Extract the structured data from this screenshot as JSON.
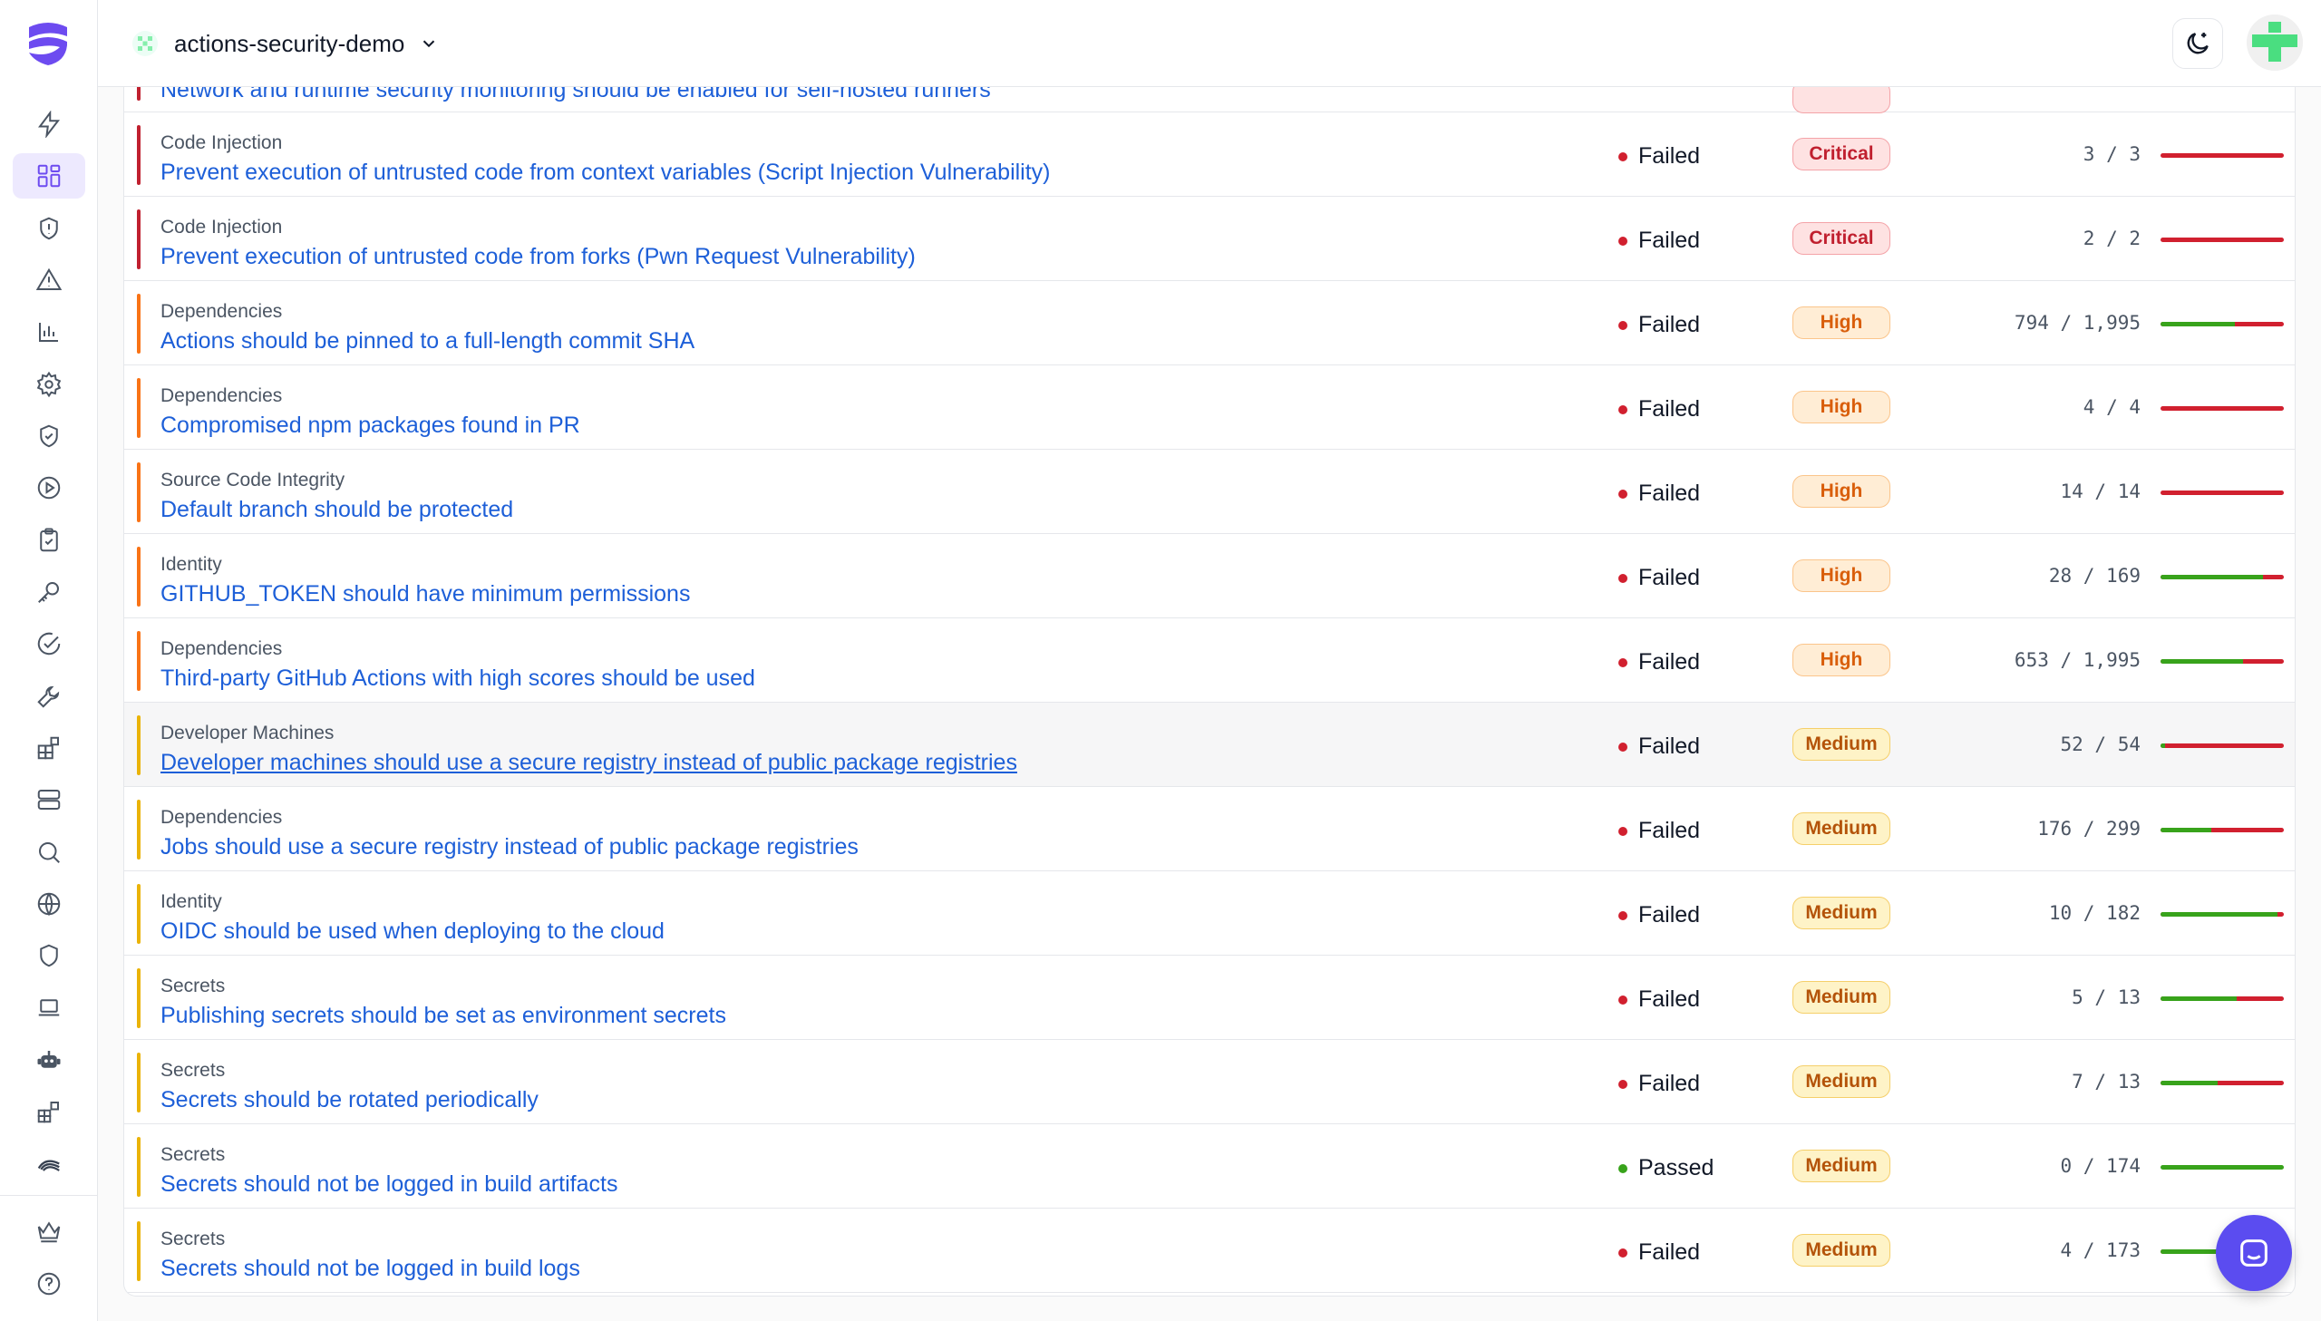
{
  "header": {
    "repo_name": "actions-security-demo"
  },
  "colors": {
    "accent": "#5b4cf0",
    "critical": "#c0202f",
    "high": "#f97316",
    "medium": "#eab308",
    "failed": "#d1202f",
    "passed": "#38a31b",
    "link": "#1d5fd8"
  },
  "sidebar": {
    "items": [
      {
        "icon": "lightning-icon"
      },
      {
        "icon": "dashboard-grid-icon",
        "active": true
      },
      {
        "icon": "shield-alert-icon"
      },
      {
        "icon": "warning-icon"
      },
      {
        "icon": "bar-chart-icon"
      },
      {
        "icon": "gear-icon"
      },
      {
        "icon": "shield-check-icon"
      },
      {
        "icon": "play-circle-icon"
      },
      {
        "icon": "clipboard-check-icon"
      },
      {
        "icon": "key-icon"
      },
      {
        "icon": "check-circle-icon"
      },
      {
        "icon": "wrench-icon"
      },
      {
        "icon": "puzzle-blocks-icon"
      },
      {
        "icon": "server-icon"
      },
      {
        "icon": "search-icon"
      },
      {
        "icon": "globe-icon"
      },
      {
        "icon": "shield-icon"
      },
      {
        "icon": "laptop-icon"
      },
      {
        "icon": "robot-icon"
      },
      {
        "icon": "blocks-icon"
      },
      {
        "icon": "waves-icon"
      },
      {
        "icon": "crown-icon"
      },
      {
        "icon": "help-icon"
      }
    ]
  },
  "top_cut_row": {
    "title": "Network and runtime security monitoring should be enabled for self-hosted runners"
  },
  "checks": [
    {
      "category": "Code Injection",
      "title": "Prevent execution of untrusted code from context variables (Script Injection Vulnerability)",
      "status": "Failed",
      "severity": "Critical",
      "failing": 3,
      "total": 3,
      "count_text": "3 / 3"
    },
    {
      "category": "Code Injection",
      "title": "Prevent execution of untrusted code from forks (Pwn Request Vulnerability)",
      "status": "Failed",
      "severity": "Critical",
      "failing": 2,
      "total": 2,
      "count_text": "2 / 2"
    },
    {
      "category": "Dependencies",
      "title": "Actions should be pinned to a full-length commit SHA",
      "status": "Failed",
      "severity": "High",
      "failing": 794,
      "total": 1995,
      "count_text": "794 / 1,995"
    },
    {
      "category": "Dependencies",
      "title": "Compromised npm packages found in PR",
      "status": "Failed",
      "severity": "High",
      "failing": 4,
      "total": 4,
      "count_text": "4 / 4"
    },
    {
      "category": "Source Code Integrity",
      "title": "Default branch should be protected",
      "status": "Failed",
      "severity": "High",
      "failing": 14,
      "total": 14,
      "count_text": "14 / 14"
    },
    {
      "category": "Identity",
      "title": "GITHUB_TOKEN should have minimum permissions",
      "status": "Failed",
      "severity": "High",
      "failing": 28,
      "total": 169,
      "count_text": "28 / 169"
    },
    {
      "category": "Dependencies",
      "title": "Third-party GitHub Actions with high scores should be used",
      "status": "Failed",
      "severity": "High",
      "failing": 653,
      "total": 1995,
      "count_text": "653 / 1,995"
    },
    {
      "category": "Developer Machines",
      "title": "Developer machines should use a secure registry instead of public package registries",
      "status": "Failed",
      "severity": "Medium",
      "failing": 52,
      "total": 54,
      "count_text": "52 / 54"
    },
    {
      "category": "Dependencies",
      "title": "Jobs should use a secure registry instead of public package registries",
      "status": "Failed",
      "severity": "Medium",
      "failing": 176,
      "total": 299,
      "count_text": "176 / 299"
    },
    {
      "category": "Identity",
      "title": "OIDC should be used when deploying to the cloud",
      "status": "Failed",
      "severity": "Medium",
      "failing": 10,
      "total": 182,
      "count_text": "10 / 182"
    },
    {
      "category": "Secrets",
      "title": "Publishing secrets should be set as environment secrets",
      "status": "Failed",
      "severity": "Medium",
      "failing": 5,
      "total": 13,
      "count_text": "5 / 13"
    },
    {
      "category": "Secrets",
      "title": "Secrets should be rotated periodically",
      "status": "Failed",
      "severity": "Medium",
      "failing": 7,
      "total": 13,
      "count_text": "7 / 13"
    },
    {
      "category": "Secrets",
      "title": "Secrets should not be logged in build artifacts",
      "status": "Passed",
      "severity": "Medium",
      "failing": 0,
      "total": 174,
      "count_text": "0 / 174"
    },
    {
      "category": "Secrets",
      "title": "Secrets should not be logged in build logs",
      "status": "Failed",
      "severity": "Medium",
      "failing": 4,
      "total": 173,
      "count_text": "4 / 173"
    }
  ]
}
